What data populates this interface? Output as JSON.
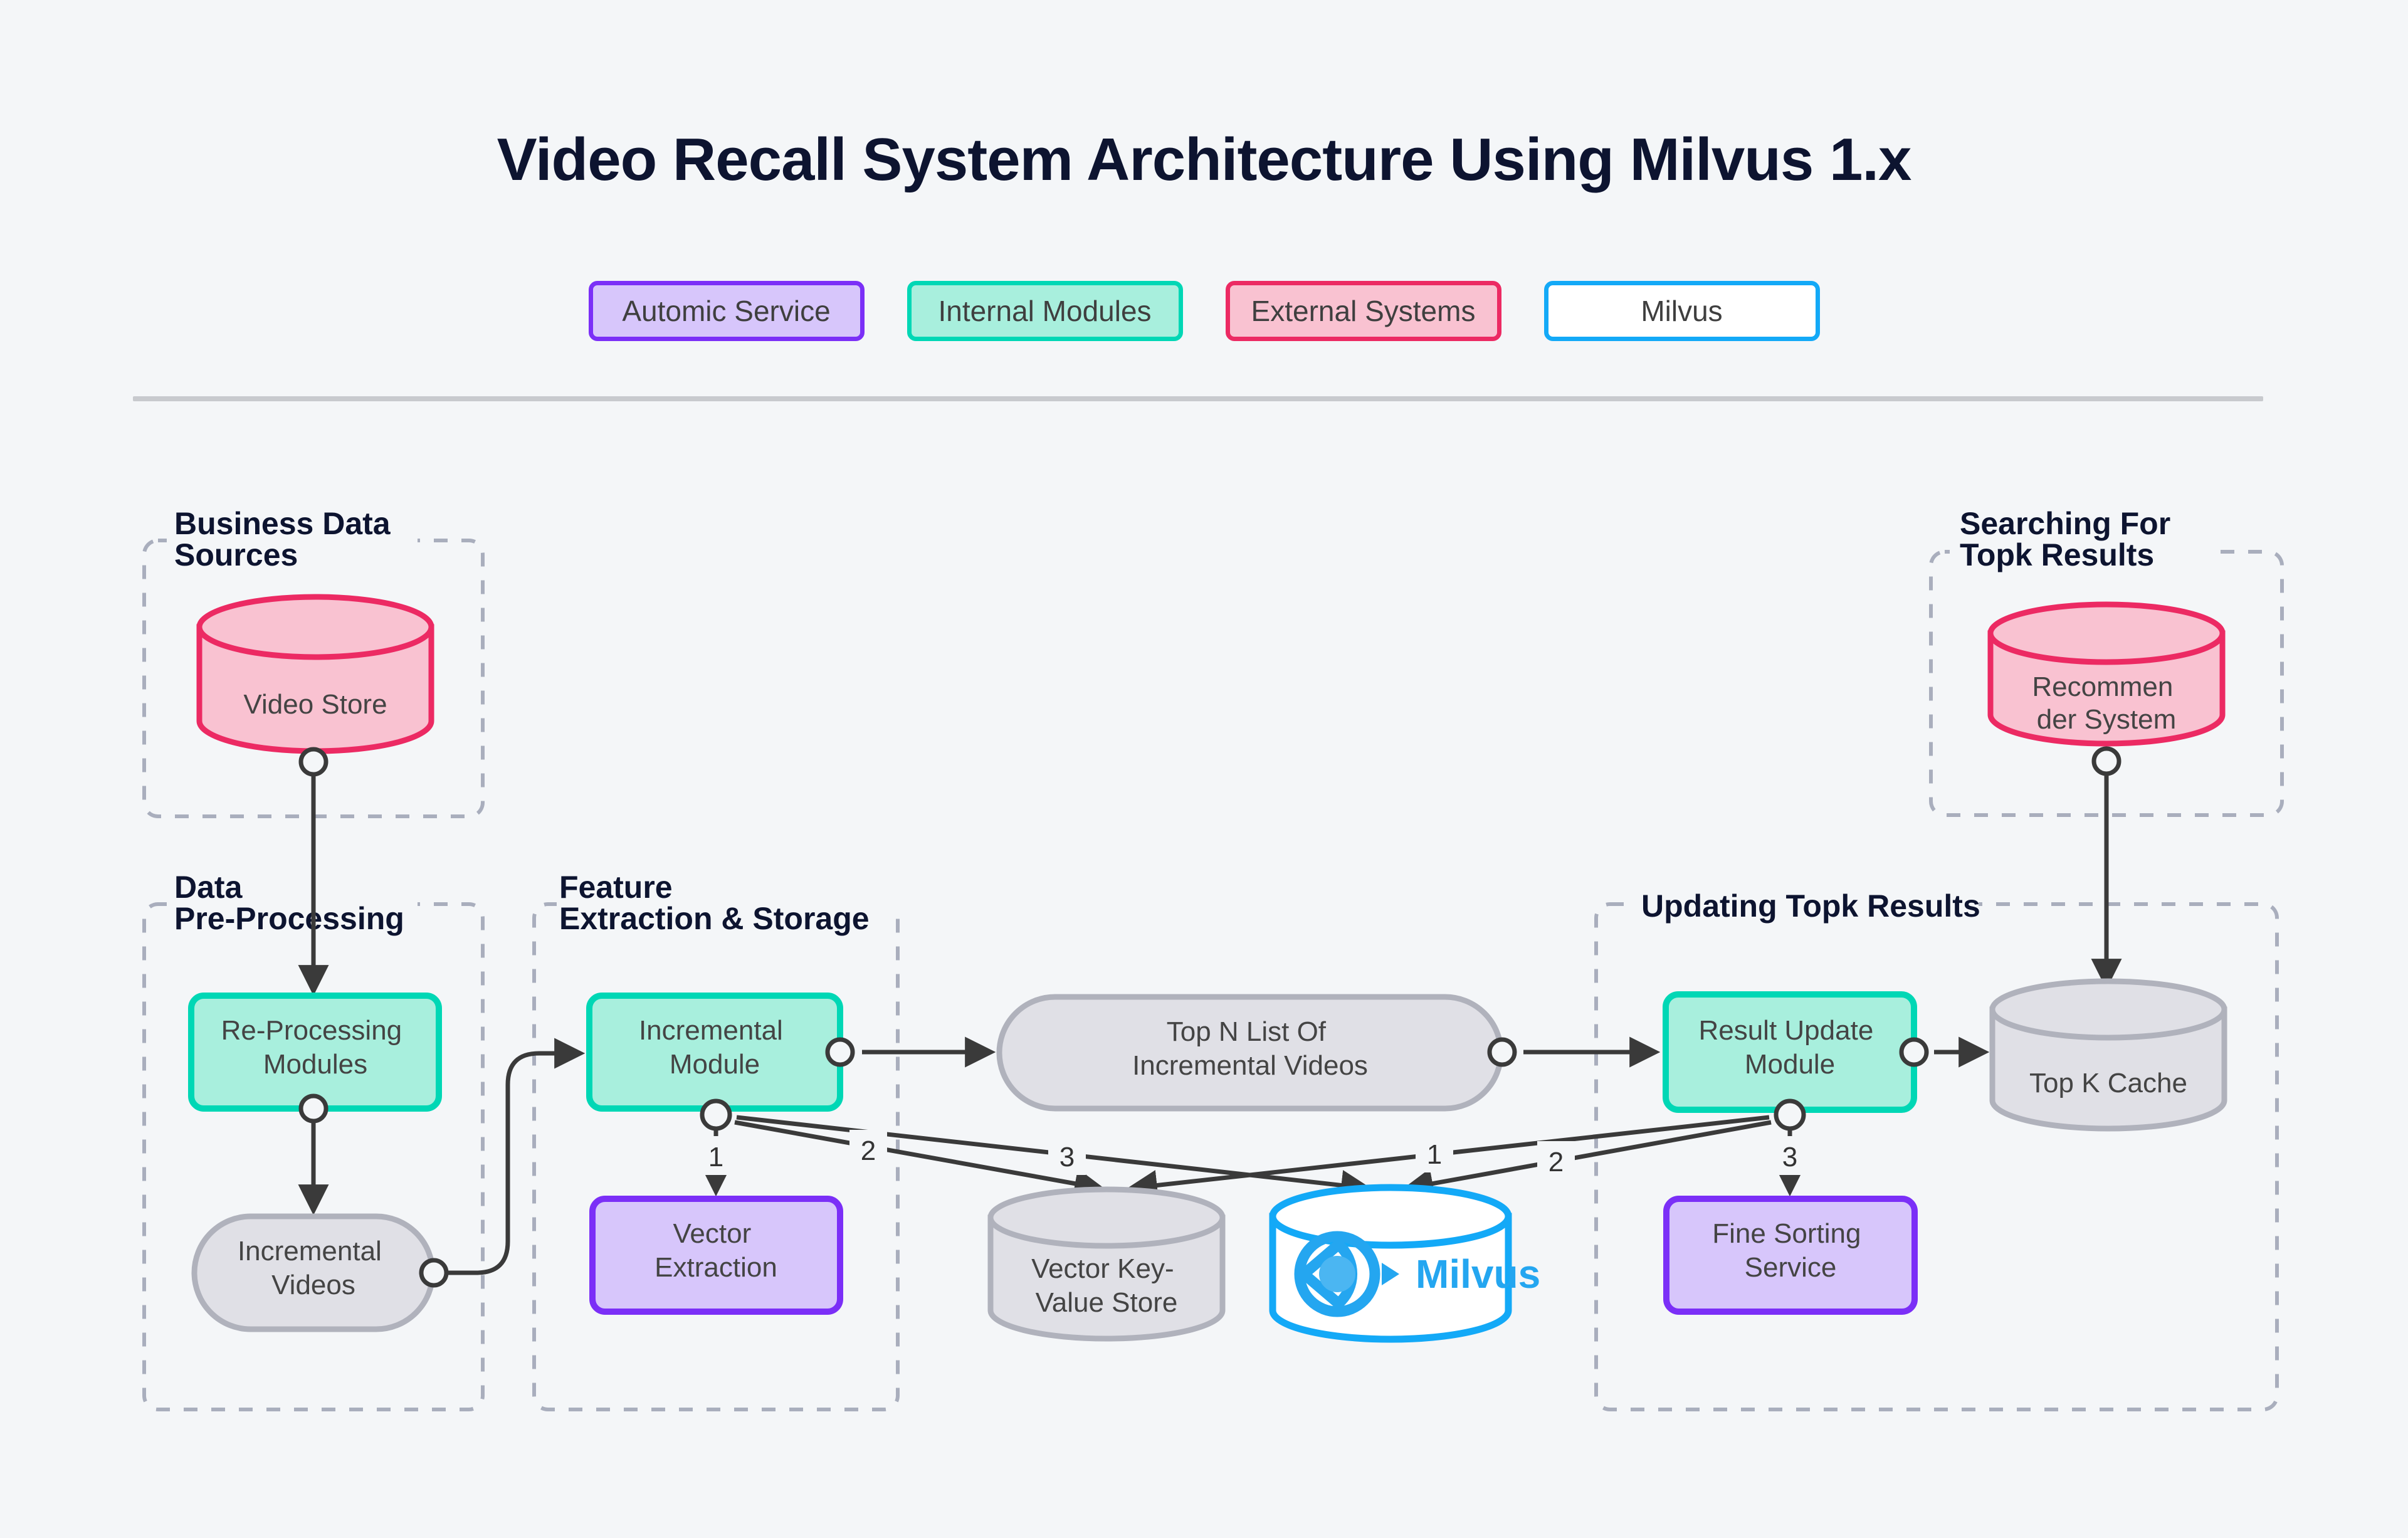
{
  "title": "Video Recall System Architecture Using Milvus 1.x",
  "legend": [
    {
      "label": "Automic Service",
      "fill": "#d7c6fb",
      "border": "#7b2ff7"
    },
    {
      "label": "Internal Modules",
      "fill": "#a8efdd",
      "border": "#00d7b5"
    },
    {
      "label": "External Systems",
      "fill": "#f9c2d1",
      "border": "#ec2a63"
    },
    {
      "label": "Milvus",
      "fill": "#ffffff",
      "border": "#13a9f7"
    }
  ],
  "subgraphs": [
    {
      "id": "business-data-sources",
      "title_line1": "Business Data",
      "title_line2": "Sources"
    },
    {
      "id": "searching-for-topk-results",
      "title_line1": "Searching For",
      "title_line2": "Topk Results"
    },
    {
      "id": "data-pre-processing",
      "title_line1": "Data",
      "title_line2": "Pre-Processing"
    },
    {
      "id": "feature-extraction-storage",
      "title_line1": "Feature",
      "title_line2": "Extraction & Storage"
    },
    {
      "id": "updating-topk-results",
      "title_line1": "Updating Topk Results",
      "title_line2": ""
    }
  ],
  "nodes": {
    "video_store": {
      "label_line1": "Video Store",
      "label_line2": ""
    },
    "recommender_system": {
      "label_line1": "Recommen",
      "label_line2": "der System"
    },
    "reprocessing_modules": {
      "label_line1": "Re-Processing",
      "label_line2": "Modules"
    },
    "incremental_videos": {
      "label_line1": "Incremental",
      "label_line2": "Videos"
    },
    "incremental_module": {
      "label_line1": "Incremental",
      "label_line2": "Module"
    },
    "vector_extraction": {
      "label_line1": "Vector",
      "label_line2": "Extraction"
    },
    "top_n_list": {
      "label_line1": "Top N List Of",
      "label_line2": "Incremental Videos"
    },
    "vector_kv_store": {
      "label_line1": "Vector Key-",
      "label_line2": "Value Store"
    },
    "milvus": {
      "label_line1": "Milvus",
      "label_line2": ""
    },
    "result_update_module": {
      "label_line1": "Result Update",
      "label_line2": "Module"
    },
    "fine_sorting_service": {
      "label_line1": "Fine Sorting",
      "label_line2": "Service"
    },
    "top_k_cache": {
      "label_line1": "Top K Cache",
      "label_line2": ""
    }
  },
  "edge_labels": {
    "incr_to_vector_extraction": "1",
    "incr_to_milvus": "2",
    "incr_to_kv_store": "3",
    "result_to_kv_store": "1",
    "result_to_milvus": "2",
    "result_to_fine_sorting": "3"
  },
  "colors": {
    "background": "#f4f6f8",
    "purple_fill": "#d7c6fb",
    "purple_border": "#7b2ff7",
    "teal_fill": "#a8efdd",
    "teal_border": "#00d7b5",
    "pink_fill": "#f9c2d1",
    "pink_border": "#ec2a63",
    "milvus_blue": "#13a9f7",
    "grey_fill": "#e0e0e6",
    "grey_border": "#b0b2bc",
    "edge_stroke": "#3a3a3a",
    "dashed_border": "#a9aebd",
    "title_color": "#0d1430",
    "node_text": "#444444"
  }
}
